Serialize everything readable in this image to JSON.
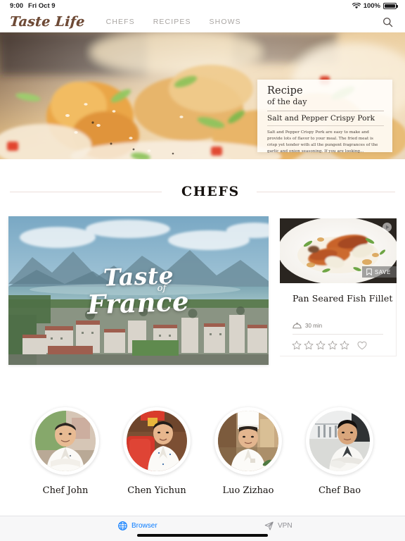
{
  "status_bar": {
    "time": "9:00",
    "date": "Fri Oct 9",
    "battery_percent": "100%",
    "wifi_icon": "wifi-icon",
    "battery_icon": "battery-icon"
  },
  "nav": {
    "logo": "Taste Life",
    "links": [
      {
        "label": "CHEFS"
      },
      {
        "label": "RECIPES"
      },
      {
        "label": "SHOWS"
      }
    ],
    "search_icon": "search-icon"
  },
  "hero": {
    "image_alt": "Salt and Pepper Crispy Pork close-up",
    "recipe_of_day": {
      "title": "Recipe",
      "subtitle": "of the day",
      "name": "Salt and Pepper Crispy Pork",
      "description": "Salt and Pepper Crispy Pork are easy to make and provide lots of flavor to your meal. The fried meat is crisp yet tender with all the pungent fragrances of the garlic and onion seasoning. If you are looking..."
    }
  },
  "chefs_section": {
    "heading": "CHEFS",
    "video_card": {
      "line1": "Taste",
      "line2": "of",
      "line3": "France",
      "image_alt": "Aerial view of Annecy lake and town in France"
    },
    "recipe_card": {
      "save_label": "SAVE",
      "save_icon": "bookmark-icon",
      "play_icon": "play-icon",
      "title": "Pan Seared Fish Fillet",
      "time": "30 min",
      "time_icon": "cloche-icon",
      "rating": 0,
      "stars_total": 5,
      "favorite_icon": "heart-icon",
      "image_alt": "Pan seared fish fillet plated with sauce"
    },
    "chefs": [
      {
        "name": "Chef John"
      },
      {
        "name": "Chen Yichun"
      },
      {
        "name": "Luo Zizhao"
      },
      {
        "name": "Chef Bao"
      }
    ]
  },
  "bottom_bar": {
    "browser_label": "Browser",
    "browser_icon": "globe-icon",
    "vpn_label": "VPN",
    "vpn_icon": "paper-plane-icon"
  },
  "colors": {
    "logo_brown": "#6e4a36",
    "nav_gray": "#a9a5a2",
    "browser_blue": "#0a7cff",
    "vpn_gray": "#8e8e93",
    "rule_pink": "#ecdedb"
  }
}
